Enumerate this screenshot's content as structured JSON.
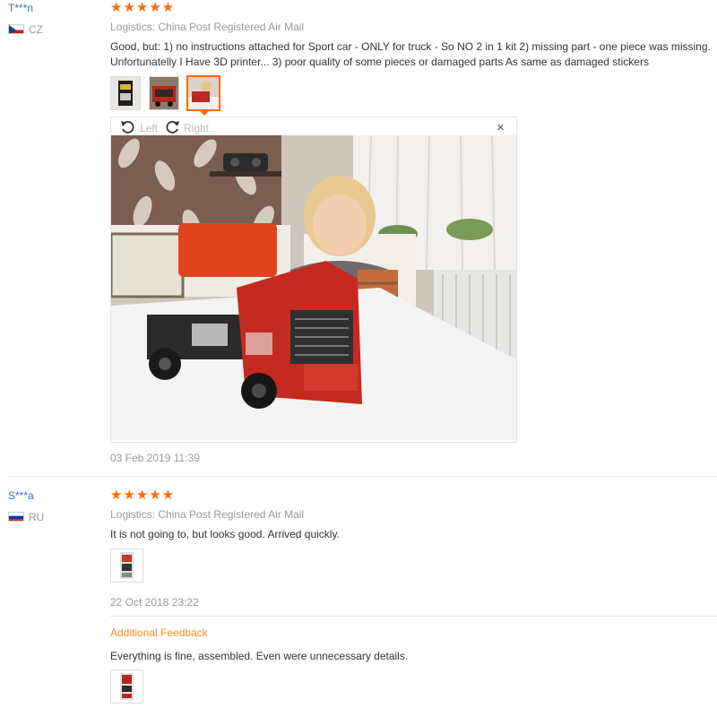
{
  "reviews": [
    {
      "user": "T***n",
      "country": "CZ",
      "stars": "★★★★★",
      "logistics": "Logistics: China Post Registered Air Mail",
      "text_line1": "Good, but: 1) no instructions attached for Sport car - ONLY for truck - So NO 2 in 1 kit 2) missing part - one piece was missing.",
      "text_line2": "Unfortunatelly I Have 3D printer... 3) poor quality of some pieces or damaged parts As same as damaged stickers",
      "viewer": {
        "left_label": "Left",
        "right_label": "Right",
        "close": "×"
      },
      "date": "03 Feb 2019 11:39"
    },
    {
      "user": "S***a",
      "country": "RU",
      "stars": "★★★★★",
      "logistics": "Logistics: China Post Registered Air Mail",
      "text": "It is not going to, but looks good. Arrived quickly.",
      "date": "22 Oct 2018 23:22",
      "additional_feedback": {
        "title": "Additional Feedback",
        "text": "Everything is fine, assembled. Even were unnecessary details."
      }
    }
  ],
  "colors": {
    "accent": "#ff6a00",
    "link": "#3b6fb6",
    "muted": "#999999"
  }
}
